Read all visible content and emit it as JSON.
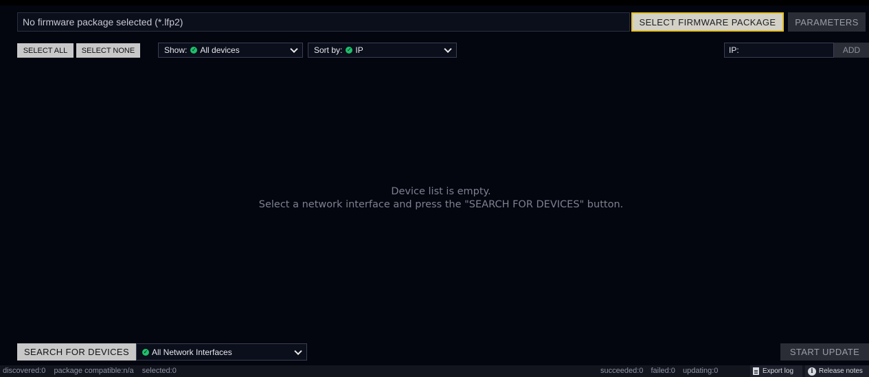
{
  "header": {
    "package_field_text": "No firmware package selected (*.lfp2)",
    "select_firmware_label": "SELECT FIRMWARE PACKAGE",
    "parameters_label": "PARAMETERS"
  },
  "toolbar": {
    "select_all_label": "SELECT ALL",
    "select_none_label": "SELECT NONE",
    "show_prefix": "Show:",
    "show_value": "All devices",
    "sort_prefix": "Sort by:",
    "sort_value": "IP",
    "ip_label": "IP:",
    "add_label": "ADD"
  },
  "device_list": {
    "empty_line1": "Device list is empty.",
    "empty_line2": "Select a network interface and press the \"SEARCH FOR DEVICES\" button."
  },
  "footer": {
    "search_label": "SEARCH FOR DEVICES",
    "interface_value": "All Network Interfaces",
    "start_update_label": "START UPDATE"
  },
  "statusbar": {
    "discovered": "discovered:0",
    "package_compatible": "package compatible:n/a",
    "selected": "selected:0",
    "succeeded": "succeeded:0",
    "failed": "failed:0",
    "updating": "updating:0",
    "export_log_label": "Export log",
    "release_notes_label": "Release notes"
  },
  "colors": {
    "background": "#03050f",
    "accent_border": "#e4c02a",
    "check_green": "#1ec06a"
  },
  "icons": {
    "check": "check-circle-icon",
    "chevron": "chevron-down-icon",
    "export": "document-icon",
    "release": "info-icon"
  }
}
